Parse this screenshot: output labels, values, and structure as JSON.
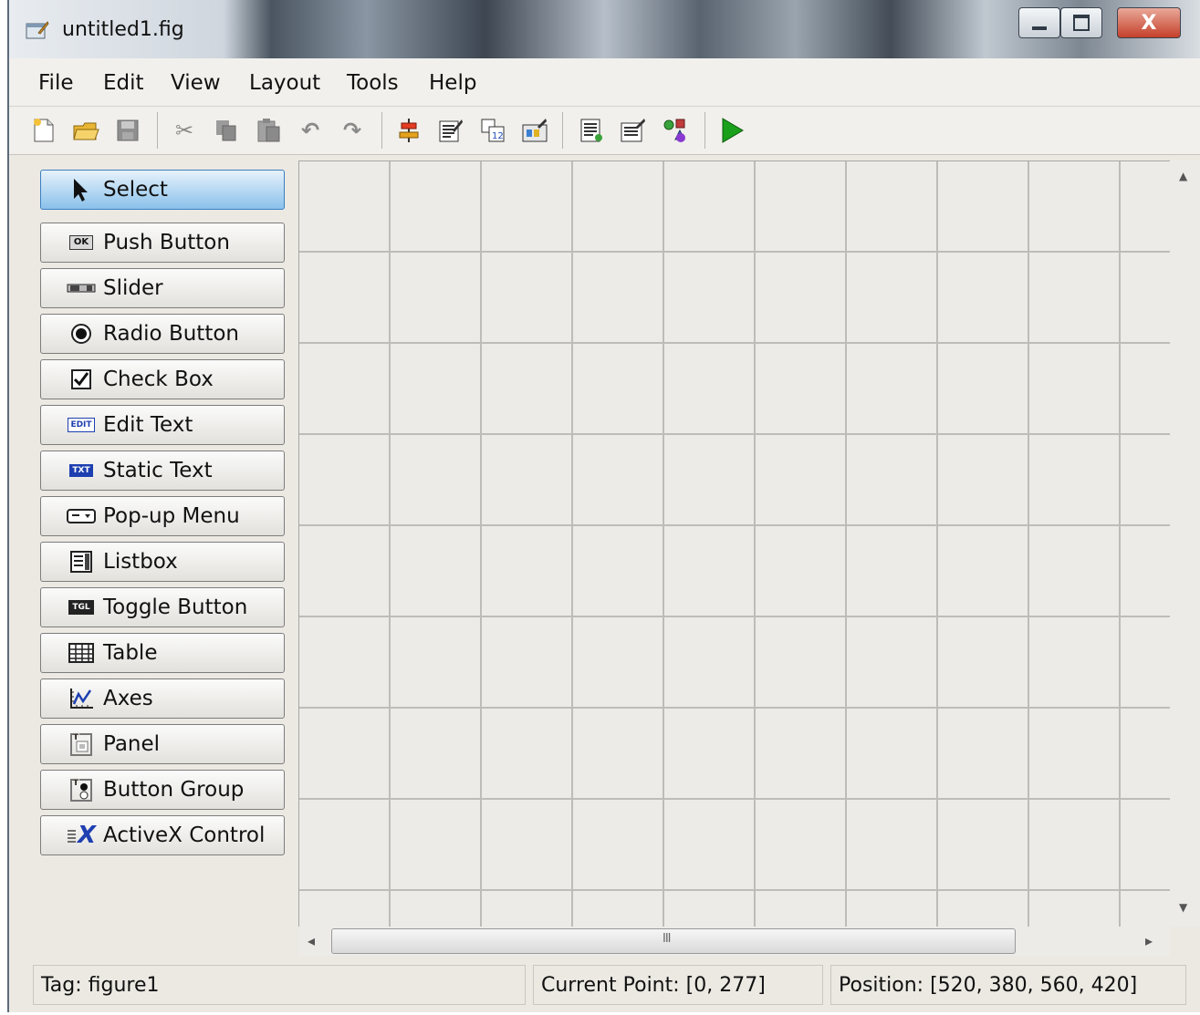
{
  "window": {
    "title": "untitled1.fig",
    "close_glyph": "X"
  },
  "menu": [
    "File",
    "Edit",
    "View",
    "Layout",
    "Tools",
    "Help"
  ],
  "toolbar": {
    "icons": [
      "new-icon",
      "open-icon",
      "save-icon",
      "cut-icon",
      "copy-icon",
      "paste-icon",
      "undo-icon",
      "redo-icon",
      "align-icon",
      "menu-editor-icon",
      "tab-order-icon",
      "toolbar-editor-icon",
      "editor-icon",
      "property-inspector-icon",
      "object-browser-icon",
      "run-icon"
    ]
  },
  "palette": [
    {
      "label": "Select",
      "icon": "arrow-icon",
      "selected": true
    },
    {
      "label": "Push Button",
      "icon": "push-button-icon",
      "glyph": "OK"
    },
    {
      "label": "Slider",
      "icon": "slider-icon"
    },
    {
      "label": "Radio Button",
      "icon": "radio-icon"
    },
    {
      "label": "Check Box",
      "icon": "checkbox-icon"
    },
    {
      "label": "Edit Text",
      "icon": "edit-text-icon",
      "glyph": "EDIT"
    },
    {
      "label": "Static Text",
      "icon": "static-text-icon",
      "glyph": "TXT"
    },
    {
      "label": "Pop-up Menu",
      "icon": "popup-menu-icon"
    },
    {
      "label": "Listbox",
      "icon": "listbox-icon"
    },
    {
      "label": "Toggle Button",
      "icon": "toggle-button-icon",
      "glyph": "TGL"
    },
    {
      "label": "Table",
      "icon": "table-icon"
    },
    {
      "label": "Axes",
      "icon": "axes-icon"
    },
    {
      "label": "Panel",
      "icon": "panel-icon"
    },
    {
      "label": "Button Group",
      "icon": "button-group-icon"
    },
    {
      "label": "ActiveX Control",
      "icon": "activex-icon",
      "glyph": "X"
    }
  ],
  "scroll": {
    "h_thumb_glyph": "III",
    "left": "◂",
    "right": "▸",
    "up": "▲",
    "down": "▼"
  },
  "status": {
    "tag": "Tag: figure1",
    "current_point": "Current Point:  [0, 277]",
    "position": "Position: [520, 380, 560, 420]"
  },
  "colors": {
    "accent": "#8ac1eb",
    "run": "#1aa01a",
    "close": "#c5402a"
  }
}
